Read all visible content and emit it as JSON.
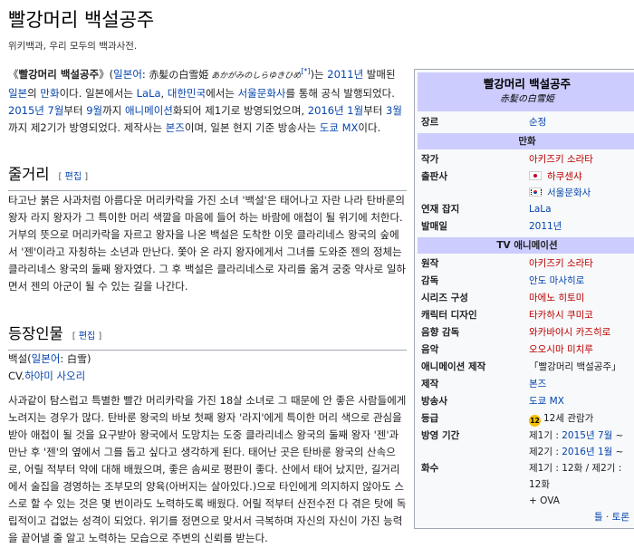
{
  "title": "빨강머리 백설공주",
  "tagline": "위키백과, 우리 모두의 백과사전.",
  "lead": {
    "q_open": "《",
    "bold_title": "빨강머리 백설공주",
    "q_close": "》(",
    "lang_link": "일본어",
    "colon": ": ",
    "jp_title": "赤髪の白雪姫",
    "reading": " あかがみのしらゆきひめ",
    "sup": "[*]",
    "t1": ")는 ",
    "year_link": "2011년",
    "t2": " 발매된 ",
    "japan_link": "일본",
    "t3": "의 ",
    "manga_link": "만화",
    "t4": "이다. 일본에서는 ",
    "lala_link": "LaLa",
    "t5": ", ",
    "korea_link": "대한민국",
    "t6": "에서는 ",
    "seoul_link": "서울문화사",
    "t7": "를 통해 공식 발행되었다. ",
    "jul2015_link": "2015년 7월",
    "t8": "부터 ",
    "sep_link": "9월",
    "t9": "까지 ",
    "anime_link": "애니메이션",
    "t10": "화되어 제1기로 방영되었으며, ",
    "jan2016_link": "2016년 1월",
    "t11": "부터 ",
    "mar_link": "3월",
    "t12": "까지 제2기가 방영되었다. 제작사는 ",
    "bones_link": "본즈",
    "t13": "이며, 일본 현지 기준 방송사는 ",
    "tokyomx_link": "도쿄 MX",
    "t14": "이다."
  },
  "plot": {
    "heading": "줄거리",
    "edit_open": "[ ",
    "edit": "편집",
    "edit_close": " ]",
    "text": "타고난 붉은 사과처럼 아름다운 머리카락을 가진 소녀 '백설'은 태어나고 자란 나라 탄바룬의 왕자 라지 왕자가 그 특이한 머리 색깔을 마음에 들어 하는 바람에 애첩이 될 위기에 처한다. 거부의 뜻으로 머리카락을 자르고 왕자을 나온 백설은 도착한 이웃 클라리네스 왕국의 숲에서 '젠'이라고 자칭하는 소년과 만난다. 쫓아 온 라지 왕자에게서 그녀를 도와준 젠의 정체는 클라리네스 왕국의 둘째 왕자였다. 그 후 백설은 클라리네스로 자리를 옮겨 궁중 약사로 일하면서 젠의 아군이 될 수 있는 길을 나간다."
  },
  "characters": {
    "heading": "등장인물",
    "edit_open": "[ ",
    "edit": "편집",
    "edit_close": " ]",
    "name": "백설",
    "name_open": "(",
    "lang_link": "일본어",
    "colon": ": ",
    "jp_name": "白雪",
    "name_close": ")",
    "cv_prefix": "CV.",
    "cv_link": "하야미 사오리",
    "desc": "사과같이 탐스럽고 특별한 빨간 머리카락을 가진 18살 소녀로 그 때문에 안 좋은 사람들에게 노려지는 경우가 많다. 탄바룬 왕국의 바보 첫째 왕자 '라지'에게 특이한 머리 색으로 관심을 받아 애첩이 될 것을 요구받아 왕국에서 도망치는 도중 클라리네스 왕국의 둘째 왕자 '젠'과 만난 후 '젠'의 옆에서 그를 돕고 싶다고 생각하게 된다. 태어난 곳은 탄바룬 왕국의 산속으로, 어릴 적부터 약에 대해 배웠으며, 좋은 솜씨로 평판이 좋다. 산에서 태어 났지만, 길거리에서 술집을 경영하는 조부모의 양육(아버지는 살아있다.)으로 타인에게 의지하지 않아도 스스로 할 수 있는 것은 몇 번이라도 노력하도록 배웠다. 어릴 적부터 산전수전 다 겪은 탓에 독립적이고 겁없는 성격이 되었다. 위기를 정면으로 맞서서 극복하며 자신의 자신이 가진 능력을 끝어낼 줄 알고 노력하는 모습으로 주변의 신뢰를 받는다."
  },
  "infobox": {
    "title": "빨강머리 백설공주",
    "subtitle": "赤髪の白雪姫",
    "rows1": [
      {
        "label": "장르",
        "value": "순정",
        "kind": "link"
      }
    ],
    "section_manga": "만화",
    "rows2": [
      {
        "label": "작가",
        "value": "아키즈키 소라타",
        "kind": "red"
      }
    ],
    "publisher_label": "출판사",
    "publisher_jp": "하쿠센샤",
    "publisher_kr": "서울문화사",
    "rows3": [
      {
        "label": "연재 잡지",
        "value": "LaLa",
        "kind": "link"
      },
      {
        "label": "발매일",
        "value": "2011년",
        "kind": "link"
      }
    ],
    "section_anime": "TV 애니메이션",
    "rows4": [
      {
        "label": "원작",
        "value": "아키즈키 소라타",
        "kind": "red"
      },
      {
        "label": "감독",
        "value": "안도 마사히로",
        "kind": "link"
      },
      {
        "label": "시리즈 구성",
        "value": "마에노 히토미",
        "kind": "red"
      },
      {
        "label": "캐릭터 디자인",
        "value": "타카하시 쿠미코",
        "kind": "red"
      },
      {
        "label": "음향 감독",
        "value": "와카바야시 카즈히로",
        "kind": "red"
      },
      {
        "label": "음악",
        "value": "오오시마 미치루",
        "kind": "red"
      },
      {
        "label": "애니메이션 제작",
        "value": "「빨강머리 백설공주」",
        "kind": "text"
      },
      {
        "label": "제작",
        "value": "본즈",
        "kind": "link"
      },
      {
        "label": "방송사",
        "value": "도쿄 MX",
        "kind": "link"
      }
    ],
    "rating_label": "등급",
    "rating_badge": "12",
    "rating_text": "12세 관람가",
    "air_label": "방영 기간",
    "air_s1_prefix": "제1기 : ",
    "air_s1_link": "2015년 7월",
    "air_s1_rest": " ~",
    "air_s2_prefix": "제2기 : ",
    "air_s2_link": "2016년 1월",
    "air_s2_rest": " ~",
    "ep_label": "화수",
    "ep_value": "제1기 : 12화 / 제2기 : 12화",
    "ep_value2": "+ OVA",
    "more": "틀 · 토론"
  }
}
